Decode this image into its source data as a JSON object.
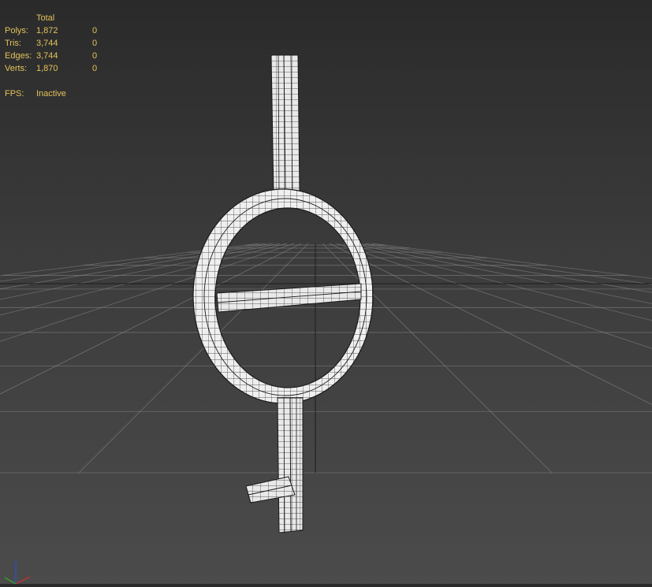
{
  "stats": {
    "header": "Total",
    "rows": [
      {
        "label": "Polys:",
        "total": "1,872",
        "selected": "0"
      },
      {
        "label": "Tris:",
        "total": "3,744",
        "selected": "0"
      },
      {
        "label": "Edges:",
        "total": "3,744",
        "selected": "0"
      },
      {
        "label": "Verts:",
        "total": "1,870",
        "selected": "0"
      }
    ],
    "fps_label": "FPS:",
    "fps_value": "Inactive"
  },
  "colors": {
    "stats_text": "#e3c25a",
    "grid_line": "#8a8a8a",
    "model_fill": "#efefef",
    "wire": "#1a1a1a",
    "axis_x": "#c03030",
    "axis_y": "#30a030",
    "axis_z": "#3050c0"
  },
  "icons": [
    "axis-gizmo-icon"
  ]
}
